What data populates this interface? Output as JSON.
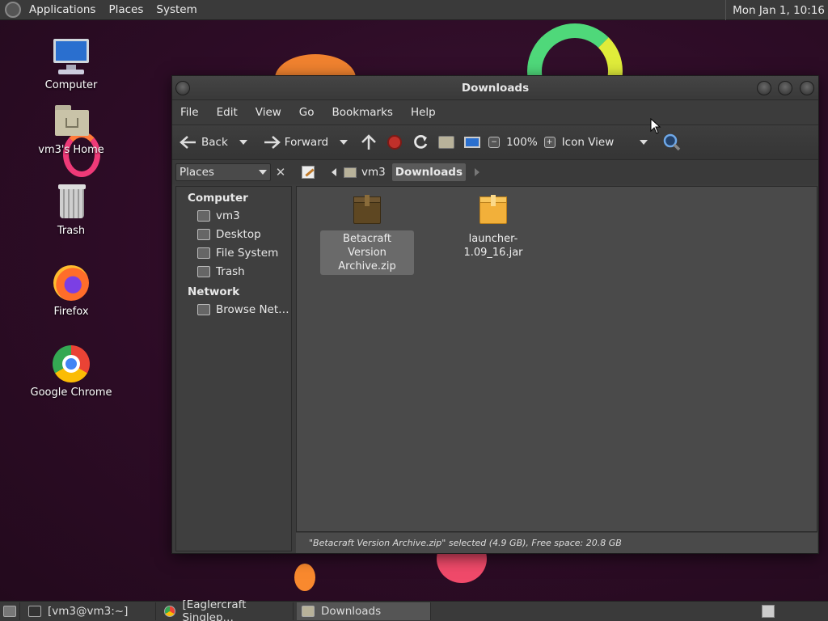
{
  "top_panel": {
    "menus": [
      "Applications",
      "Places",
      "System"
    ],
    "clock": "Mon Jan 1, 10:16"
  },
  "desktop_icons": [
    {
      "label": "Computer",
      "icon": "computer-icon"
    },
    {
      "label": "vm3's Home",
      "icon": "home-folder-icon"
    },
    {
      "label": "Trash",
      "icon": "trash-icon"
    },
    {
      "label": "Firefox",
      "icon": "firefox-icon"
    },
    {
      "label": "Google Chrome",
      "icon": "chrome-icon"
    }
  ],
  "window": {
    "title": "Downloads",
    "menus": [
      "File",
      "Edit",
      "View",
      "Go",
      "Bookmarks",
      "Help"
    ],
    "toolbar": {
      "back": "Back",
      "forward": "Forward",
      "zoom": "100%",
      "view_mode": "Icon View"
    },
    "location": {
      "places_label": "Places",
      "crumbs": [
        "vm3",
        "Downloads"
      ]
    },
    "sidebar": {
      "computer_header": "Computer",
      "computer_items": [
        "vm3",
        "Desktop",
        "File System",
        "Trash"
      ],
      "network_header": "Network",
      "network_items": [
        "Browse Net…"
      ]
    },
    "files": [
      {
        "name": "Betacraft Version Archive.zip",
        "selected": true,
        "icon": "zip-archive-icon"
      },
      {
        "name": "launcher-1.09_16.jar",
        "selected": false,
        "icon": "jar-archive-icon"
      }
    ],
    "status": "\"Betacraft Version Archive.zip\" selected (4.9 GB), Free space: 20.8 GB"
  },
  "taskbar": [
    {
      "label": "[vm3@vm3:~]",
      "active": false
    },
    {
      "label": "[Eaglercraft Singlep…",
      "active": false
    },
    {
      "label": "Downloads",
      "active": true
    }
  ],
  "colors": {
    "accent_orange": "#f5a02a",
    "desktop_bg": "#2d0c26"
  }
}
